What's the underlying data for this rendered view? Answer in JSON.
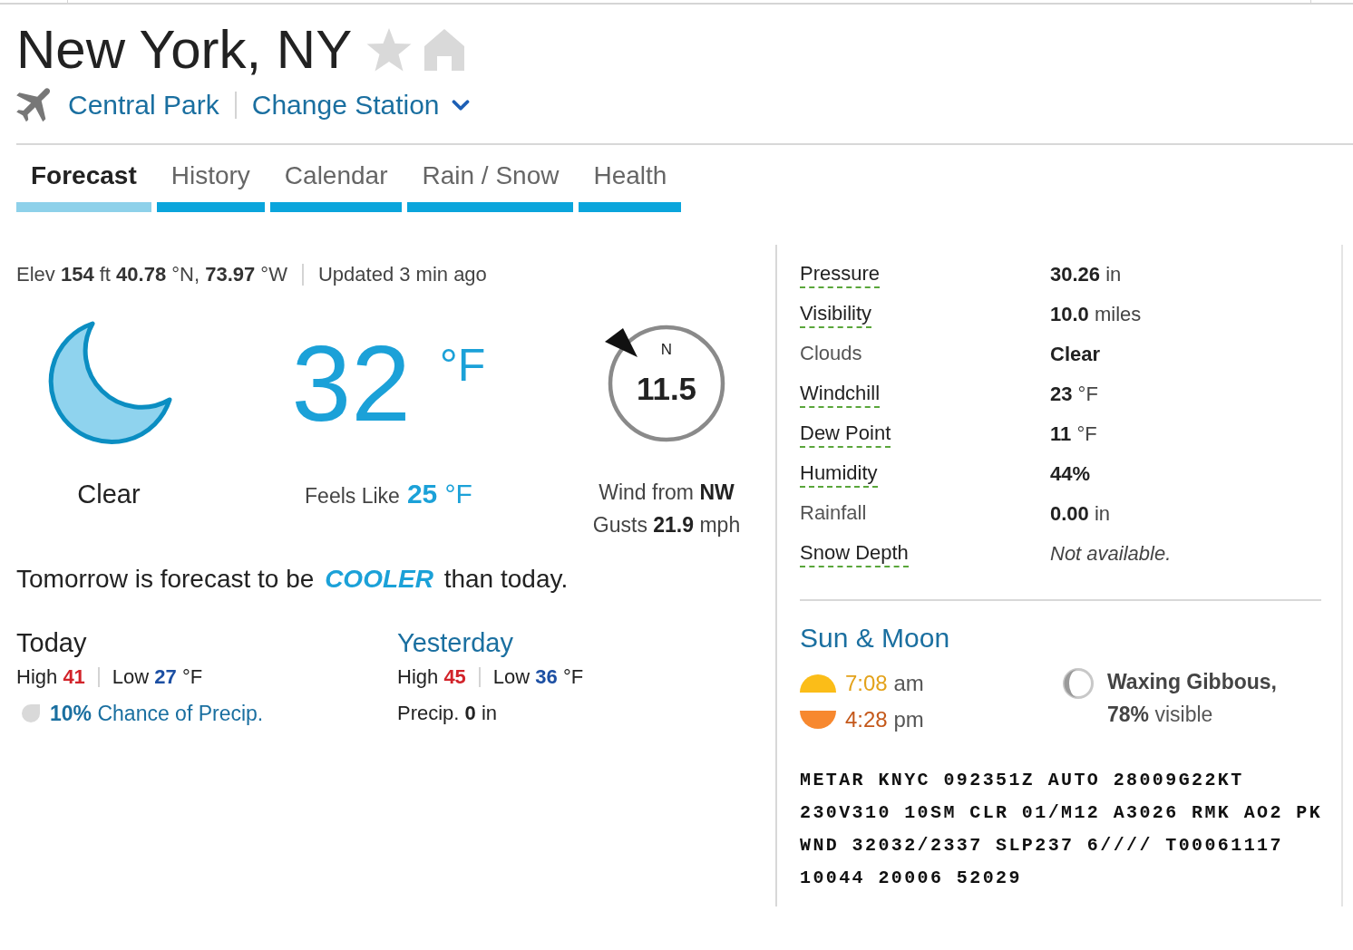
{
  "location": {
    "title": "New York, NY"
  },
  "station": {
    "name": "Central Park",
    "change_label": "Change Station"
  },
  "tabs": [
    {
      "label": "Forecast",
      "selected": true
    },
    {
      "label": "History",
      "selected": false
    },
    {
      "label": "Calendar",
      "selected": false
    },
    {
      "label": "Rain / Snow",
      "selected": false
    },
    {
      "label": "Health",
      "selected": false
    }
  ],
  "observation": {
    "elevation": "Elev **154** ft **40.78** °N, **73.97** °W",
    "updated": "Updated 3 min ago",
    "condition": "Clear",
    "temperature": "32",
    "temperature_unit": "°F",
    "feels_like_label": "Feels Like",
    "feels_like": "25",
    "feels_like_unit": "°F",
    "wind": {
      "compass_label": "N",
      "speed": "11.5",
      "direction_text": "Wind from **NW**",
      "gusts_text": "Gusts **21.9** mph"
    }
  },
  "outlook": "Tomorrow is forecast to be **COOLER** than today.",
  "days": [
    {
      "kind": "forecast",
      "title": "Today",
      "high_label": "High",
      "high": "41",
      "low_label": "Low",
      "low": "27",
      "unit": "°F",
      "precip": "**10%** Chance of Precip."
    },
    {
      "kind": "history",
      "title": "Yesterday",
      "high_label": "High",
      "high": "45",
      "low_label": "Low",
      "low": "36",
      "unit": "°F",
      "precip": "Precip. **0** in"
    }
  ],
  "conditions": [
    {
      "label": "Pressure",
      "defined": true,
      "kind": "measure",
      "value": "30.26",
      "unit": "in"
    },
    {
      "label": "Visibility",
      "defined": true,
      "kind": "measure",
      "value": "10.0",
      "unit": "miles"
    },
    {
      "label": "Clouds",
      "defined": false,
      "kind": "measure",
      "value": "Clear"
    },
    {
      "label": "Windchill",
      "defined": true,
      "kind": "measure",
      "value": "23",
      "unit": "°F"
    },
    {
      "label": "Dew Point",
      "defined": true,
      "kind": "measure",
      "value": "11",
      "unit": "°F"
    },
    {
      "label": "Humidity",
      "defined": true,
      "kind": "measure",
      "value": "44%"
    },
    {
      "label": "Rainfall",
      "defined": false,
      "kind": "measure",
      "value": "0.00",
      "unit": "in"
    },
    {
      "label": "Snow Depth",
      "defined": true,
      "kind": "unavailable",
      "value": "Not available."
    }
  ],
  "sun_moon": {
    "title": "Sun & Moon",
    "sun": [
      {
        "kind": "sunrise",
        "time": "7:08",
        "period": "am"
      },
      {
        "kind": "sunset",
        "time": "4:28",
        "period": "pm"
      }
    ],
    "moon": {
      "phase": "Waxing Gibbous,",
      "visible": "**78%** visible"
    }
  },
  "metar": "METAR KNYC 092351Z AUTO 28009G22KT 230V310 10SM CLR 01/M12 A3026 RMK AO2 PK WND 32032/2337 SLP237 6//// T00061117 10044 20006 52029"
}
